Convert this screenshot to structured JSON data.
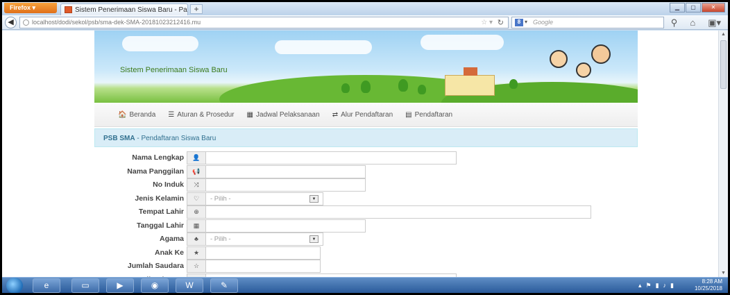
{
  "browser": {
    "menu_button": "Firefox",
    "tab_title": "Sistem Penerimaan Siswa Baru - Palemb...",
    "new_tab": "+",
    "url": "localhost/dodi/sekol/psb/sma-dek-SMA-20181023212416.mu",
    "search_placeholder": "Google"
  },
  "site": {
    "banner_title": "Sistem Penerimaan Siswa Baru",
    "menu": [
      {
        "label": "Beranda",
        "icon": "home-icon",
        "glyph": "🏠"
      },
      {
        "label": "Aturan & Prosedur",
        "icon": "list-icon",
        "glyph": "☰"
      },
      {
        "label": "Jadwal Pelaksanaan",
        "icon": "calendar-icon",
        "glyph": "▦"
      },
      {
        "label": "Alur Pendaftaran",
        "icon": "retweet-icon",
        "glyph": "⇄"
      },
      {
        "label": "Pendaftaran",
        "icon": "form-icon",
        "glyph": "▤"
      }
    ],
    "heading_bold": "PSB SMA",
    "heading_rest": " - Pendaftaran Siswa Baru"
  },
  "form": {
    "fields": [
      {
        "label": "Nama Lengkap",
        "icon": "user-icon",
        "glyph": "👤",
        "type": "text",
        "value": ""
      },
      {
        "label": "Nama Panggilan",
        "icon": "bullhorn-icon",
        "glyph": "📢",
        "type": "text",
        "value": ""
      },
      {
        "label": "No Induk",
        "icon": "random-icon",
        "glyph": "⤨",
        "type": "text",
        "value": ""
      },
      {
        "label": "Jenis Kelamin",
        "icon": "heart-icon",
        "glyph": "♡",
        "type": "select",
        "value": "- Pilih -"
      },
      {
        "label": "Tempat Lahir",
        "icon": "globe-icon",
        "glyph": "⊕",
        "type": "text",
        "value": ""
      },
      {
        "label": "Tanggal Lahir",
        "icon": "calendar-icon",
        "glyph": "▦",
        "type": "text",
        "value": ""
      },
      {
        "label": "Agama",
        "icon": "bell-icon",
        "glyph": "♣",
        "type": "select",
        "value": "- Pilih -"
      },
      {
        "label": "Anak Ke",
        "icon": "star-icon",
        "glyph": "★",
        "type": "text",
        "value": ""
      },
      {
        "label": "Jumlah Saudara",
        "icon": "star-empty-icon",
        "glyph": "☆",
        "type": "text",
        "value": ""
      },
      {
        "label": "Status di Keluarga",
        "icon": "pushpin-icon",
        "glyph": "✎",
        "type": "text",
        "value": ""
      }
    ]
  },
  "taskbar": {
    "time": "8:28 AM",
    "date": "10/25/2018"
  }
}
